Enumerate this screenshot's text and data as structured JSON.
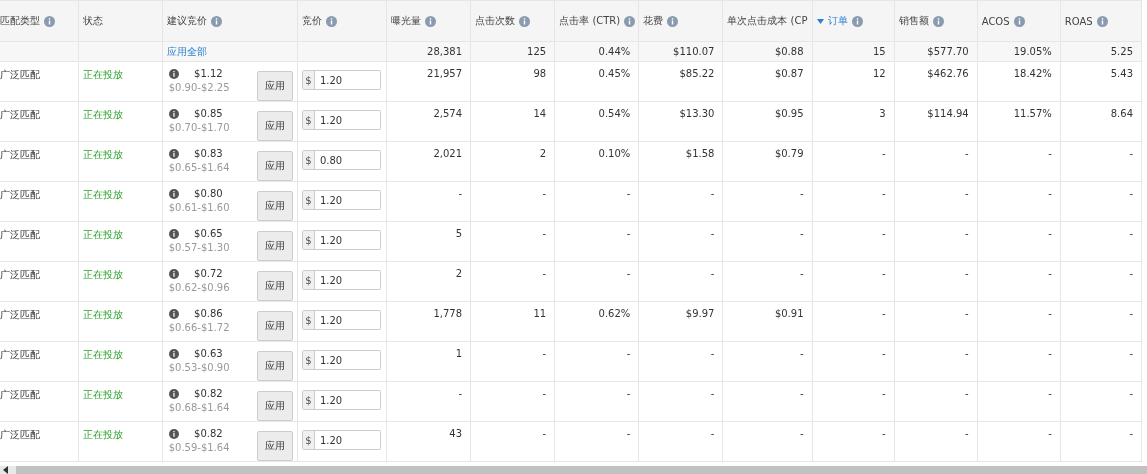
{
  "columns": [
    {
      "label": "匹配类型",
      "info": true
    },
    {
      "label": "状态",
      "info": false
    },
    {
      "label": "建议竞价",
      "info": true
    },
    {
      "label": "竞价",
      "info": true
    },
    {
      "label": "曝光量",
      "info": true
    },
    {
      "label": "点击次数",
      "info": true
    },
    {
      "label": "点击率 (CTR)",
      "info": true
    },
    {
      "label": "花费",
      "info": true
    },
    {
      "label": "单次点击成本 (CP",
      "info": false
    },
    {
      "label": "订单",
      "info": true,
      "sorted": true
    },
    {
      "label": "销售额",
      "info": true
    },
    {
      "label": "ACOS",
      "info": true
    },
    {
      "label": "ROAS",
      "info": true
    }
  ],
  "summary": {
    "apply_all": "应用全部",
    "metrics": [
      "28,381",
      "125",
      "0.44%",
      "$110.07",
      "$0.88",
      "15",
      "$577.70",
      "19.05%",
      "5.25"
    ]
  },
  "rows": [
    {
      "match_type": "广泛匹配",
      "status": "正在投放",
      "suggested": "$1.12",
      "range": "$0.90-$2.25",
      "apply": "应用",
      "currency": "$",
      "bid": "1.20",
      "metrics": [
        "21,957",
        "98",
        "0.45%",
        "$85.22",
        "$0.87",
        "12",
        "$462.76",
        "18.42%",
        "5.43"
      ]
    },
    {
      "match_type": "广泛匹配",
      "status": "正在投放",
      "suggested": "$0.85",
      "range": "$0.70-$1.70",
      "apply": "应用",
      "currency": "$",
      "bid": "1.20",
      "metrics": [
        "2,574",
        "14",
        "0.54%",
        "$13.30",
        "$0.95",
        "3",
        "$114.94",
        "11.57%",
        "8.64"
      ]
    },
    {
      "match_type": "广泛匹配",
      "status": "正在投放",
      "suggested": "$0.83",
      "range": "$0.65-$1.64",
      "apply": "应用",
      "currency": "$",
      "bid": "0.80",
      "metrics": [
        "2,021",
        "2",
        "0.10%",
        "$1.58",
        "$0.79",
        "-",
        "-",
        "-",
        "-"
      ]
    },
    {
      "match_type": "广泛匹配",
      "status": "正在投放",
      "suggested": "$0.80",
      "range": "$0.61-$1.60",
      "apply": "应用",
      "currency": "$",
      "bid": "1.20",
      "metrics": [
        "-",
        "-",
        "-",
        "-",
        "-",
        "-",
        "-",
        "-",
        "-"
      ]
    },
    {
      "match_type": "广泛匹配",
      "status": "正在投放",
      "suggested": "$0.65",
      "range": "$0.57-$1.30",
      "apply": "应用",
      "currency": "$",
      "bid": "1.20",
      "metrics": [
        "5",
        "-",
        "-",
        "-",
        "-",
        "-",
        "-",
        "-",
        "-"
      ]
    },
    {
      "match_type": "广泛匹配",
      "status": "正在投放",
      "suggested": "$0.72",
      "range": "$0.62-$0.96",
      "apply": "应用",
      "currency": "$",
      "bid": "1.20",
      "metrics": [
        "2",
        "-",
        "-",
        "-",
        "-",
        "-",
        "-",
        "-",
        "-"
      ]
    },
    {
      "match_type": "广泛匹配",
      "status": "正在投放",
      "suggested": "$0.86",
      "range": "$0.66-$1.72",
      "apply": "应用",
      "currency": "$",
      "bid": "1.20",
      "metrics": [
        "1,778",
        "11",
        "0.62%",
        "$9.97",
        "$0.91",
        "-",
        "-",
        "-",
        "-"
      ]
    },
    {
      "match_type": "广泛匹配",
      "status": "正在投放",
      "suggested": "$0.63",
      "range": "$0.53-$0.90",
      "apply": "应用",
      "currency": "$",
      "bid": "1.20",
      "metrics": [
        "1",
        "-",
        "-",
        "-",
        "-",
        "-",
        "-",
        "-",
        "-"
      ]
    },
    {
      "match_type": "广泛匹配",
      "status": "正在投放",
      "suggested": "$0.82",
      "range": "$0.68-$1.64",
      "apply": "应用",
      "currency": "$",
      "bid": "1.20",
      "metrics": [
        "-",
        "-",
        "-",
        "-",
        "-",
        "-",
        "-",
        "-",
        "-"
      ]
    },
    {
      "match_type": "广泛匹配",
      "status": "正在投放",
      "suggested": "$0.82",
      "range": "$0.59-$1.64",
      "apply": "应用",
      "currency": "$",
      "bid": "1.20",
      "metrics": [
        "43",
        "-",
        "-",
        "-",
        "-",
        "-",
        "-",
        "-",
        "-"
      ]
    }
  ]
}
